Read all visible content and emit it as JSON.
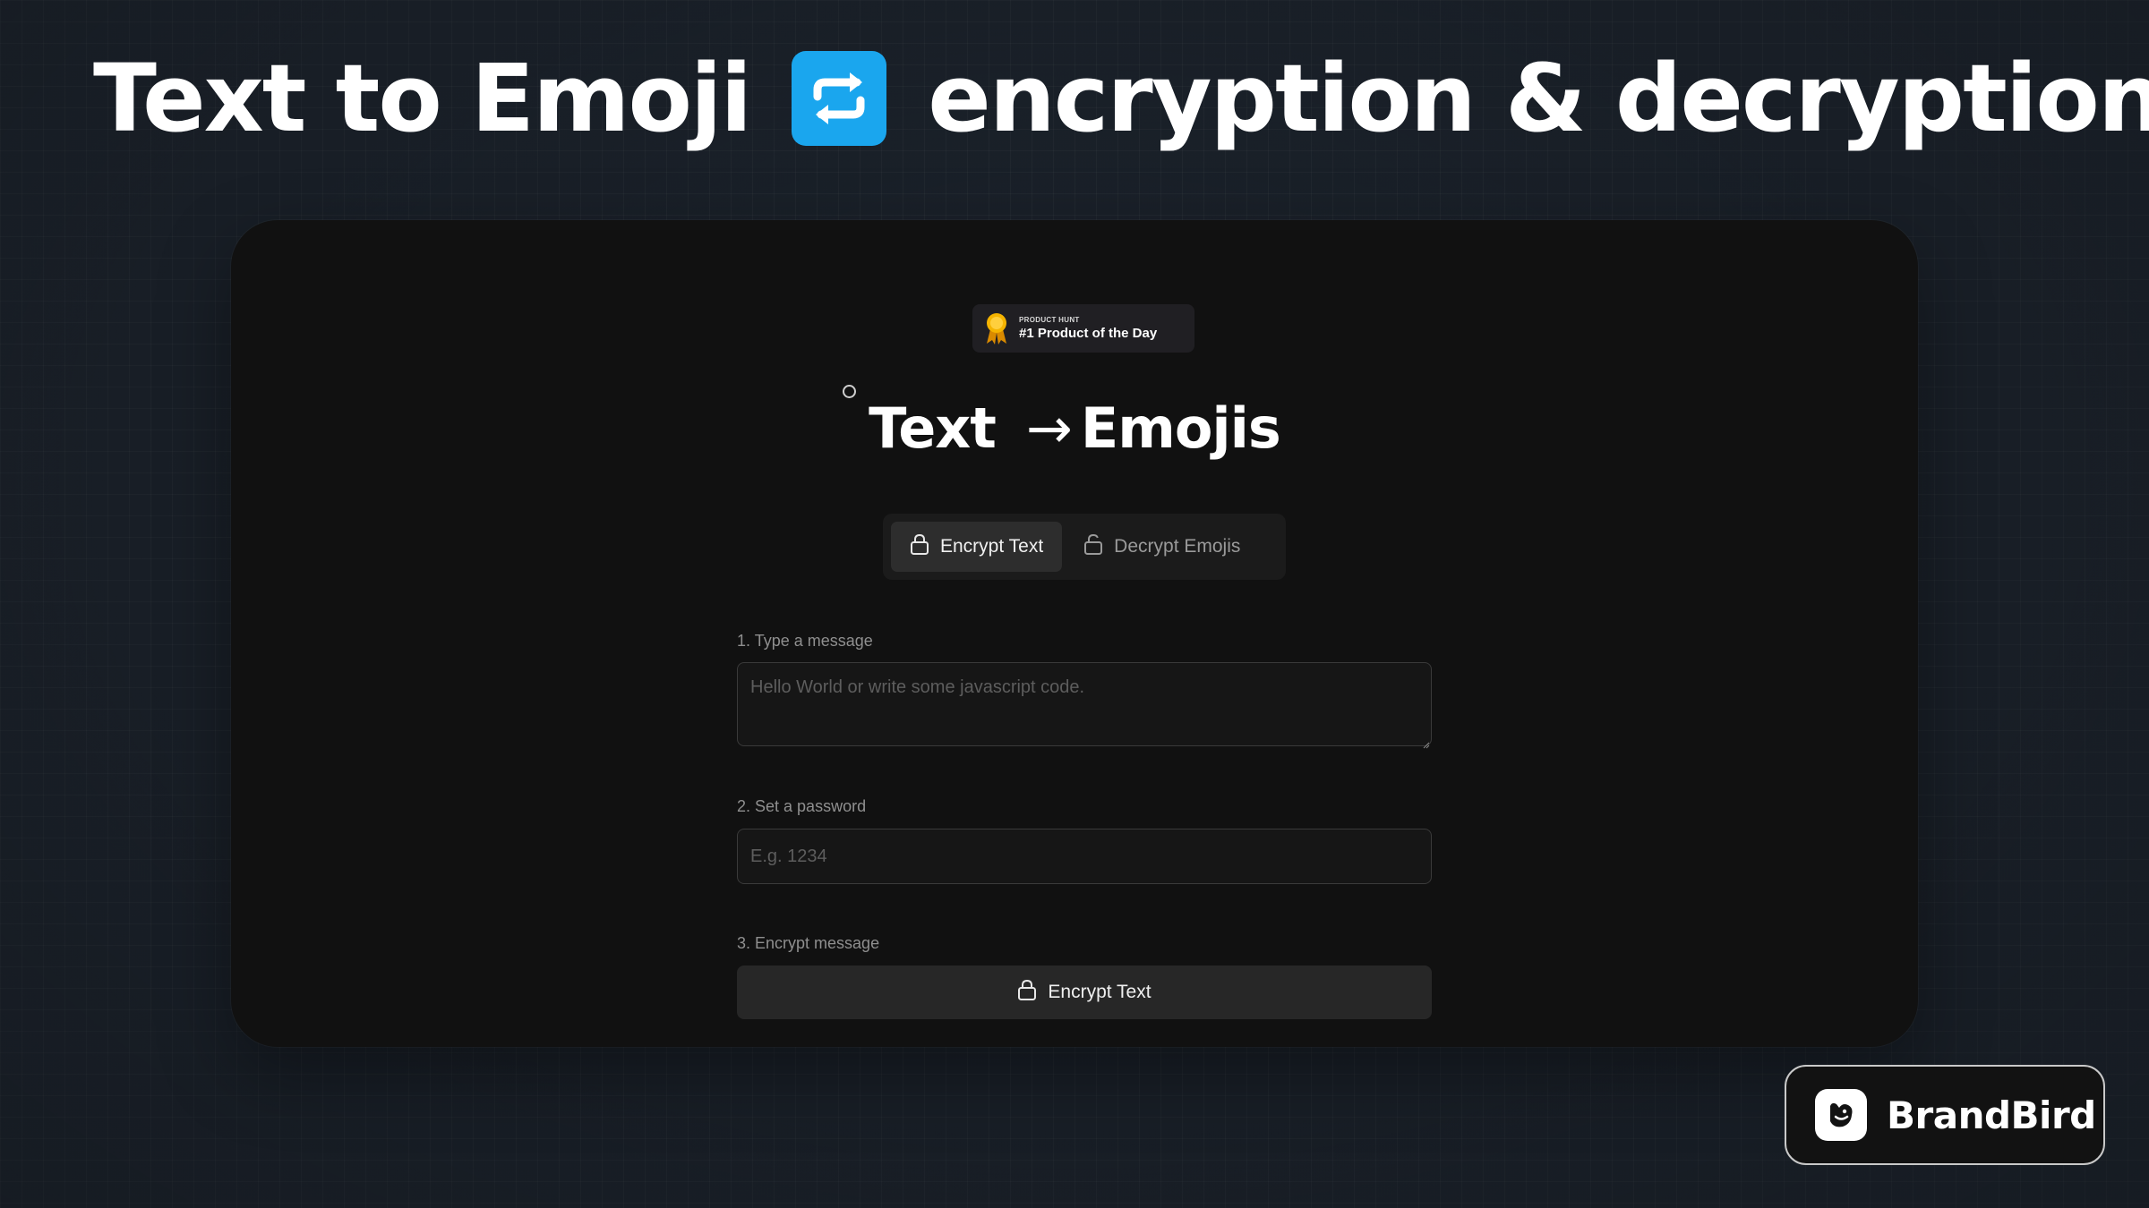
{
  "headline": {
    "left_text": "Text to Emoji",
    "emoji": "repeat-button-emoji",
    "right_text": "encryption & decryption."
  },
  "badge": {
    "source": "PRODUCT HUNT",
    "title": "#1 Product of the Day",
    "icon": "medal-icon"
  },
  "app": {
    "title_left": "Text",
    "title_arrow": "→",
    "title_right": "Emojis"
  },
  "tabs": [
    {
      "label": "Encrypt Text",
      "icon": "lock-icon",
      "active": true
    },
    {
      "label": "Decrypt Emojis",
      "icon": "unlock-icon",
      "active": false
    }
  ],
  "form": {
    "message_label": "1. Type a message",
    "message_placeholder": "Hello World or write some javascript code.",
    "password_label": "2. Set a password",
    "password_placeholder": "E.g. 1234",
    "encrypt_label": "3. Encrypt message",
    "encrypt_button": "Encrypt Text"
  },
  "watermark": {
    "brand": "BrandBird"
  },
  "colors": {
    "background": "#1b222b",
    "card": "#111111",
    "emoji_blue": "#1aa6ee",
    "medal_gold": "#f5b400",
    "text_muted": "#8f8f8f"
  }
}
